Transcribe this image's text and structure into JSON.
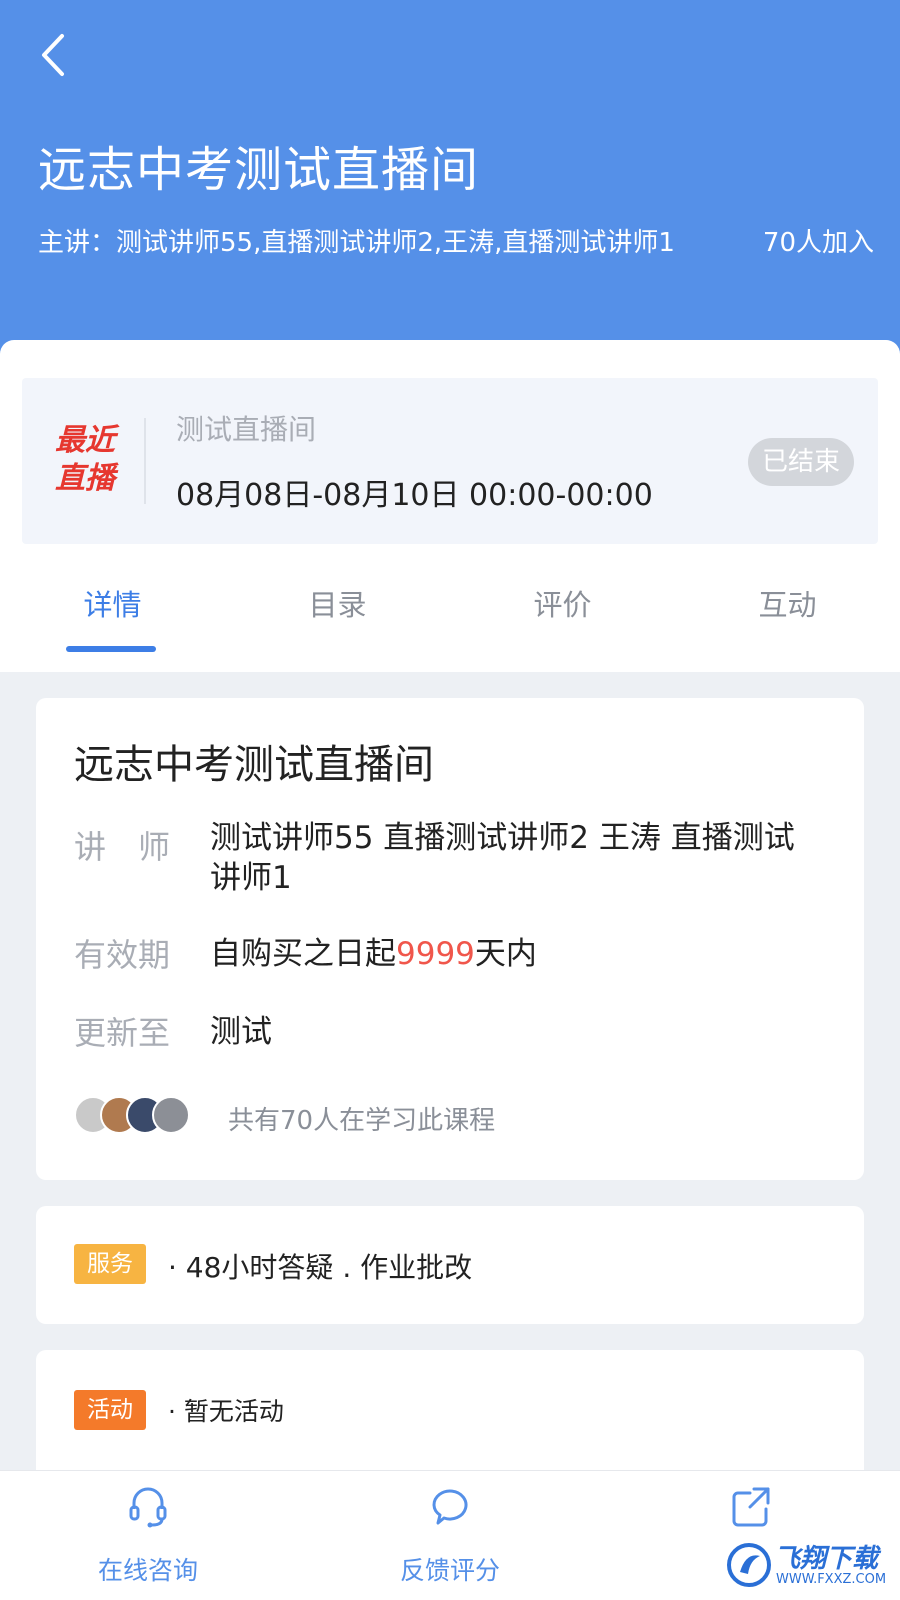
{
  "header": {
    "title": "远志中考测试直播间",
    "lecturers": "主讲：测试讲师55,直播测试讲师2,王涛,直播测试讲师1",
    "join_count": "70人加入"
  },
  "live": {
    "label": "最近直播",
    "name": "测试直播间",
    "time": "08月08日-08月10日  00:00-00:00",
    "status": "已结束"
  },
  "tabs": [
    {
      "label": "详情",
      "active": true
    },
    {
      "label": "目录",
      "active": false
    },
    {
      "label": "评价",
      "active": false
    },
    {
      "label": "互动",
      "active": false
    }
  ],
  "detail": {
    "title": "远志中考测试直播间",
    "teacher_label": "讲　师",
    "teacher_value": "测试讲师55 直播测试讲师2 王涛 直播测试讲师1",
    "validity_label": "有效期",
    "validity_prefix": "自购买之日起",
    "validity_days": "9999",
    "validity_suffix": "天内",
    "update_label": "更新至",
    "update_value": "测试",
    "learners_text": "共有70人在学习此课程"
  },
  "service": {
    "tag": "服务",
    "text": "· 48小时答疑 . 作业批改"
  },
  "activity": {
    "tag": "活动",
    "text": "· 暂无活动"
  },
  "bottom_nav": [
    {
      "label": "在线咨询",
      "icon": "headset-icon"
    },
    {
      "label": "反馈评分",
      "icon": "chat-bubble-icon"
    },
    {
      "label": "",
      "icon": "share-icon"
    }
  ],
  "watermark": {
    "text": "飞翔下载",
    "url": "WWW.FXXZ.COM"
  },
  "colors": {
    "header_blue": "#5590e8",
    "tab_active": "#3d7ee6",
    "live_red": "#e6372f",
    "service_tag": "#f7b442",
    "activity_tag": "#f47a2a",
    "highlight_red": "#f0564b"
  }
}
